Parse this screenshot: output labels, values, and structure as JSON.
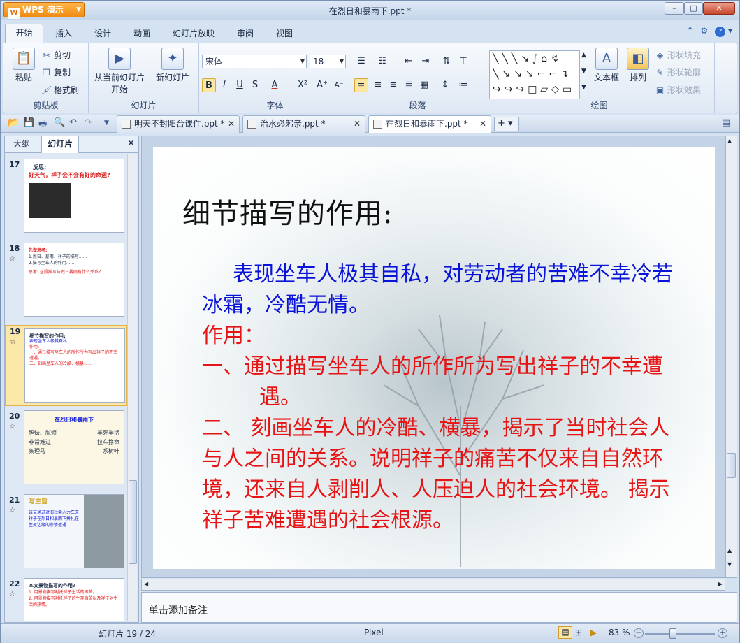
{
  "app": {
    "name": "WPS 演示",
    "logo": "W",
    "title": "在烈日和暴雨下.ppt *"
  },
  "window_controls": {
    "minimize": "–",
    "maximize": "□",
    "close": "✕"
  },
  "ribbon_tabs": [
    "开始",
    "插入",
    "设计",
    "动画",
    "幻灯片放映",
    "审阅",
    "视图"
  ],
  "ribbon_icons": {
    "collapse": "^",
    "skin": "⚙",
    "help": "?",
    "help_arrow": "▾"
  },
  "clipboard": {
    "paste": "粘贴",
    "cut": "剪切",
    "copy": "复制",
    "format_painter": "格式刷",
    "label": "剪贴板"
  },
  "slides_group": {
    "from_current": "从当前幻灯片",
    "from_current2": "开始",
    "new_slide": "新幻灯片",
    "label": "幻灯片"
  },
  "font_group": {
    "font_name": "宋体",
    "font_size": "18",
    "bold": "B",
    "italic": "I",
    "underline": "U",
    "strike": "S",
    "font_color": "A",
    "superscript": "X²",
    "grow": "A⁺",
    "shrink": "A⁻",
    "label": "字体"
  },
  "paragraph_group": {
    "label": "段落"
  },
  "drawing_group": {
    "textbox": "文本框",
    "arrange": "排列",
    "shape_fill": "形状填充",
    "shape_outline": "形状轮廓",
    "shape_effect": "形状效果",
    "label": "绘图"
  },
  "doc_tabs": [
    {
      "name": "明天不封阳台课件.ppt *",
      "close": "✕"
    },
    {
      "name": "治水必躬亲.ppt *",
      "close": "✕"
    },
    {
      "name": "在烈日和暴雨下.ppt *",
      "close": "✕"
    }
  ],
  "add_tab": "+ ▾",
  "left_pane": {
    "tabs": [
      "大纲",
      "幻灯片"
    ],
    "close": "✕",
    "thumbs": [
      {
        "num": "17",
        "star": "",
        "lines": [
          "反思:",
          "好天气，祥子会不会有好的命运?"
        ]
      },
      {
        "num": "18",
        "star": "☆",
        "lines": [
          "先做思考:",
          "1.烈日、暴雨、祥子的描写……",
          "2.描写坐车人的作用……",
          "思考: 这段描写与烈日暴雨有什么关系?"
        ]
      },
      {
        "num": "19",
        "star": "☆",
        "lines": [
          "细节描写的作用:",
          "表现坐车人极其自私……",
          "作用:",
          "一、通过描写坐车人的所作所为写出祥子的不幸遭遇。",
          "二、刻画坐车人的冷酷、横暴……"
        ]
      },
      {
        "num": "20",
        "star": "☆",
        "lines": [
          "在烈日和暴雨下",
          "胆怯、腻烦",
          "非常难过",
          "条理马",
          "半死半活",
          "拉车挣命",
          "系树叶"
        ]
      },
      {
        "num": "21",
        "star": "☆",
        "lines": [
          "写主旨",
          "该文通过对旧社会人力车夫祥子在烈日和暴雨下拼扎在生死边缘的悲惨遭遇……"
        ]
      },
      {
        "num": "22",
        "star": "☆",
        "lines": [
          "本文景物描写的作用?",
          "1. 用景物描写衬托祥子生活的困苦。",
          "2. 用景物描写衬托祥子的生存痛苦以及祥子对生活的热情。"
        ]
      }
    ]
  },
  "slide": {
    "title": "细节描写的作用:",
    "p1": "表现坐车人极其自私，对劳动者的苦难不幸冷若冰霜，冷酷无情。",
    "p2": "作用：",
    "p3": "一、通过描写坐车人的所作所为写出祥子的不幸遭遇。",
    "p4": "二、 刻画坐车人的冷酷、横暴，揭示了当时社会人与人之间的关系。说明祥子的痛苦不仅来自自然环境，还来自人剥削人、人压迫人的社会环境。 揭示祥子苦难遭遇的社会根源。"
  },
  "notes": "单击添加备注",
  "status": {
    "slide_counter": "幻灯片 19 / 24",
    "theme": "Pixel",
    "zoom": "83 %",
    "zoom_minus": "−",
    "zoom_plus": "+"
  },
  "colors": {
    "title_text": "#111111",
    "body_blue": "#0a14d8",
    "body_red": "#e61414",
    "selected_thumb": "#fbe7a8"
  }
}
